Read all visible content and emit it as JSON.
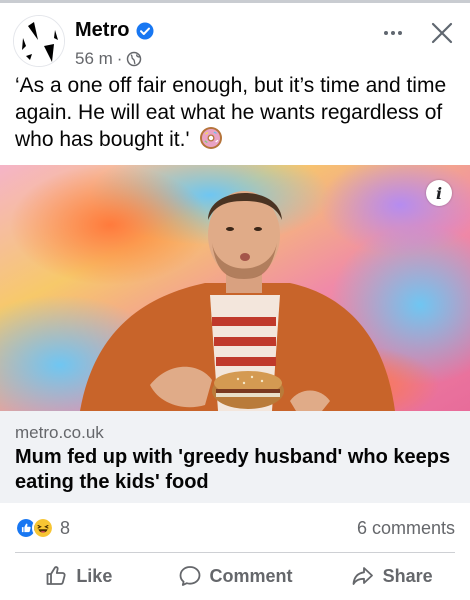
{
  "post": {
    "page_name": "Metro",
    "time": "56 m",
    "separator": "·",
    "caption": "‘As a one off fair enough, but it’s time and time again. He will eat what he wants regardless of who has bought it.'",
    "caption_emoji": "doughnut-emoji"
  },
  "link": {
    "domain": "metro.co.uk",
    "headline": "Mum fed up with 'greedy husband' who keeps eating the kids' food"
  },
  "reactions": {
    "types": [
      "like",
      "haha"
    ],
    "count": "8",
    "comments": "6 comments"
  },
  "actions": {
    "like": "Like",
    "comment": "Comment",
    "share": "Share"
  },
  "colors": {
    "verified_blue": "#1877f2",
    "muted_text": "#65676b",
    "preview_bg": "#f0f2f5"
  }
}
